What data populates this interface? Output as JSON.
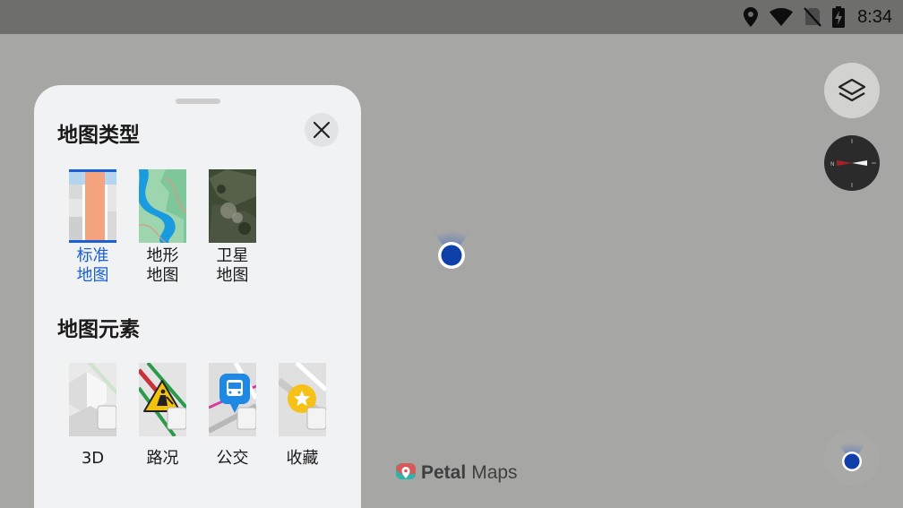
{
  "status_bar": {
    "time": "8:34",
    "icons": [
      "location-pin-icon",
      "wifi-icon",
      "no-sim-icon",
      "battery-charging-icon"
    ]
  },
  "map": {
    "brand_name_bold": "Petal",
    "brand_name_light": "Maps",
    "buttons": [
      "layers-icon",
      "compass-icon",
      "my-location-icon"
    ]
  },
  "panel": {
    "map_type_title": "地图类型",
    "map_types": [
      {
        "label": "标准\n地图",
        "selected": true
      },
      {
        "label": "地形\n地图",
        "selected": false
      },
      {
        "label": "卫星\n地图",
        "selected": false
      }
    ],
    "elements_title": "地图元素",
    "elements": [
      {
        "label": "3D"
      },
      {
        "label": "路况"
      },
      {
        "label": "公交"
      },
      {
        "label": "收藏"
      }
    ]
  },
  "colors": {
    "accent": "#1a5fd6",
    "location_dot": "#0f3fa8",
    "panel_bg": "#f1f2f4",
    "map_bg": "#a6a6a4"
  }
}
